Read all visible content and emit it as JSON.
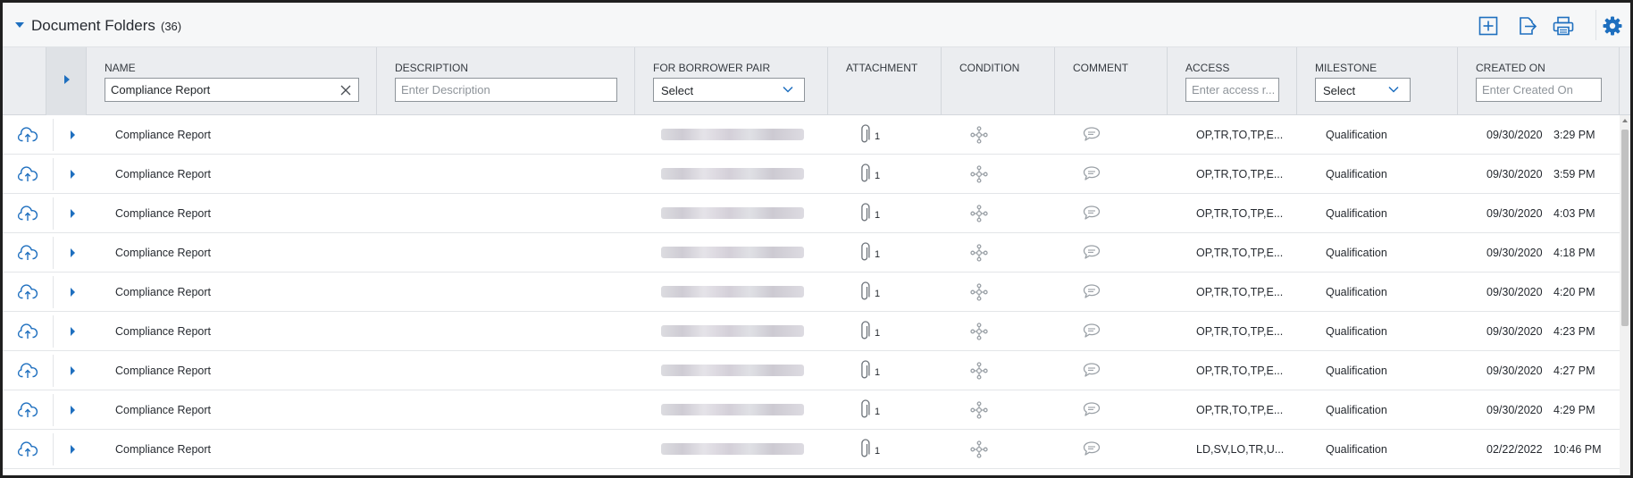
{
  "title_bar": {
    "title": "Document Folders",
    "count": "(36)",
    "icons": [
      "add-icon",
      "export-icon",
      "print-icon",
      "settings-icon"
    ]
  },
  "columns": {
    "name": {
      "label": "NAME",
      "value": "Compliance Report"
    },
    "description": {
      "label": "DESCRIPTION",
      "placeholder": "Enter Description"
    },
    "borrower_pair": {
      "label": "FOR BORROWER PAIR",
      "selected": "Select"
    },
    "attachment": {
      "label": "ATTACHMENT"
    },
    "condition": {
      "label": "CONDITION"
    },
    "comment": {
      "label": "COMMENT"
    },
    "access": {
      "label": "ACCESS",
      "placeholder": "Enter access r..."
    },
    "milestone": {
      "label": "MILESTONE",
      "selected": "Select"
    },
    "created_on": {
      "label": "CREATED ON",
      "placeholder": "Enter Created On"
    }
  },
  "rows": [
    {
      "name": "Compliance Report",
      "attachments": "1",
      "access": "OP,TR,TO,TP,E...",
      "milestone": "Qualification",
      "date": "09/30/2020",
      "time": "3:29 PM"
    },
    {
      "name": "Compliance Report",
      "attachments": "1",
      "access": "OP,TR,TO,TP,E...",
      "milestone": "Qualification",
      "date": "09/30/2020",
      "time": "3:59 PM"
    },
    {
      "name": "Compliance Report",
      "attachments": "1",
      "access": "OP,TR,TO,TP,E...",
      "milestone": "Qualification",
      "date": "09/30/2020",
      "time": "4:03 PM"
    },
    {
      "name": "Compliance Report",
      "attachments": "1",
      "access": "OP,TR,TO,TP,E...",
      "milestone": "Qualification",
      "date": "09/30/2020",
      "time": "4:18 PM"
    },
    {
      "name": "Compliance Report",
      "attachments": "1",
      "access": "OP,TR,TO,TP,E...",
      "milestone": "Qualification",
      "date": "09/30/2020",
      "time": "4:20 PM"
    },
    {
      "name": "Compliance Report",
      "attachments": "1",
      "access": "OP,TR,TO,TP,E...",
      "milestone": "Qualification",
      "date": "09/30/2020",
      "time": "4:23 PM"
    },
    {
      "name": "Compliance Report",
      "attachments": "1",
      "access": "OP,TR,TO,TP,E...",
      "milestone": "Qualification",
      "date": "09/30/2020",
      "time": "4:27 PM"
    },
    {
      "name": "Compliance Report",
      "attachments": "1",
      "access": "OP,TR,TO,TP,E...",
      "milestone": "Qualification",
      "date": "09/30/2020",
      "time": "4:29 PM"
    },
    {
      "name": "Compliance Report",
      "attachments": "1",
      "access": "LD,SV,LO,TR,U...",
      "milestone": "Qualification",
      "date": "02/22/2022",
      "time": "10:46 PM"
    }
  ],
  "colors": {
    "accent": "#1e6fbf",
    "header_bg": "#ebedf0",
    "icon_gray": "#8b9097"
  }
}
